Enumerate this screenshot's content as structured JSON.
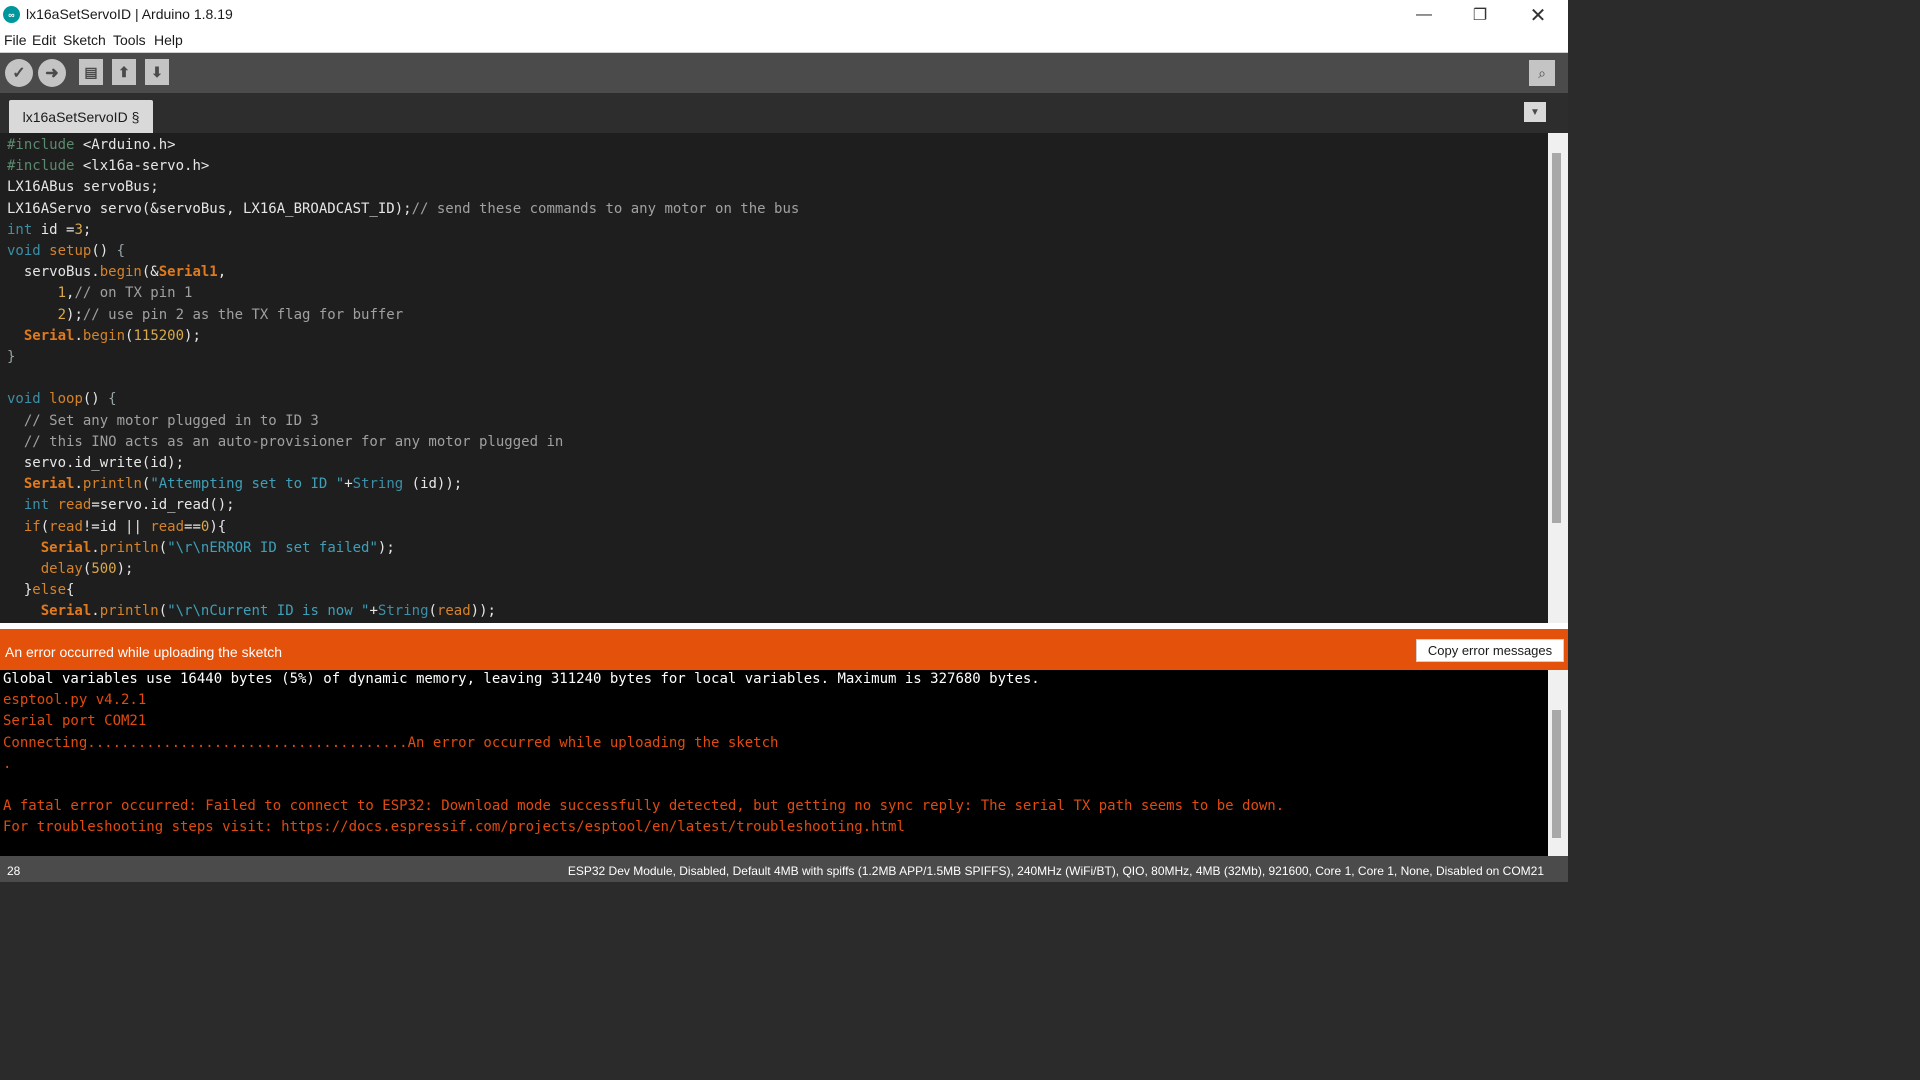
{
  "window": {
    "title": "lx16aSetServoID | Arduino 1.8.19",
    "app_icon_glyph": "∞",
    "minimize_glyph": "—",
    "maximize_glyph": "❐",
    "close_glyph": "✕"
  },
  "menu": [
    "File",
    "Edit",
    "Sketch",
    "Tools",
    "Help"
  ],
  "toolbar": {
    "verify_glyph": "✓",
    "upload_glyph": "➜",
    "new_glyph": "▤",
    "open_glyph": "⬆",
    "save_glyph": "⬇",
    "serial_monitor_glyph": "⌕"
  },
  "tabs": {
    "active": "lx16aSetServoID §",
    "menu_glyph": "▼"
  },
  "editor_lines": [
    [
      [
        "#include",
        "pre"
      ],
      [
        " <Arduino.h>",
        ""
      ]
    ],
    [
      [
        "#include",
        "pre"
      ],
      [
        " <lx16a-servo.h>",
        ""
      ]
    ],
    [
      [
        "LX16ABus servoBus;",
        ""
      ]
    ],
    [
      [
        "LX16AServo servo(&servoBus, LX16A_BROADCAST_ID);",
        ""
      ],
      [
        "// send these commands to any motor on the bus",
        "cm"
      ]
    ],
    [
      [
        "int",
        "kw"
      ],
      [
        " id =",
        ""
      ],
      [
        "3",
        "num"
      ],
      [
        ";",
        ""
      ]
    ],
    [
      [
        "void",
        "kw"
      ],
      [
        " ",
        ""
      ],
      [
        "setup",
        "fn"
      ],
      [
        "() ",
        ""
      ],
      [
        "{",
        "brace"
      ]
    ],
    [
      [
        "  servoBus.",
        ""
      ],
      [
        "begin",
        "fn"
      ],
      [
        "(&",
        ""
      ],
      [
        "Serial1",
        "cls"
      ],
      [
        ",",
        ""
      ]
    ],
    [
      [
        "      ",
        ""
      ],
      [
        "1",
        "num"
      ],
      [
        ",",
        ""
      ],
      [
        "// on TX pin 1",
        "cm"
      ]
    ],
    [
      [
        "      ",
        ""
      ],
      [
        "2",
        "num"
      ],
      [
        ");",
        ""
      ],
      [
        "// use pin 2 as the TX flag for buffer",
        "cm"
      ]
    ],
    [
      [
        "  ",
        ""
      ],
      [
        "Serial",
        "cls"
      ],
      [
        ".",
        ""
      ],
      [
        "begin",
        "fn"
      ],
      [
        "(",
        ""
      ],
      [
        "115200",
        "num"
      ],
      [
        ");",
        ""
      ]
    ],
    [
      [
        "}",
        "brace"
      ]
    ],
    [],
    [
      [
        "void",
        "kw"
      ],
      [
        " ",
        ""
      ],
      [
        "loop",
        "fn"
      ],
      [
        "() ",
        ""
      ],
      [
        "{",
        "brace"
      ]
    ],
    [
      [
        "  // Set any motor plugged in to ID 3",
        "cm"
      ]
    ],
    [
      [
        "  // this INO acts as an auto-provisioner for any motor plugged in",
        "cm"
      ]
    ],
    [
      [
        "  servo.id_write(id);",
        ""
      ]
    ],
    [
      [
        "  ",
        ""
      ],
      [
        "Serial",
        "cls"
      ],
      [
        ".",
        ""
      ],
      [
        "println",
        "fn"
      ],
      [
        "(",
        ""
      ],
      [
        "\"Attempting set to ID \"",
        "str"
      ],
      [
        "+",
        ""
      ],
      [
        "String",
        "kw"
      ],
      [
        " (id));",
        ""
      ]
    ],
    [
      [
        "  ",
        ""
      ],
      [
        "int",
        "kw"
      ],
      [
        " ",
        ""
      ],
      [
        "read",
        "fn"
      ],
      [
        "=servo.id_read();",
        ""
      ]
    ],
    [
      [
        "  ",
        ""
      ],
      [
        "if",
        "fn"
      ],
      [
        "(",
        ""
      ],
      [
        "read",
        "fn"
      ],
      [
        "!=id || ",
        ""
      ],
      [
        "read",
        "fn"
      ],
      [
        "==",
        ""
      ],
      [
        "0",
        "num"
      ],
      [
        "){",
        ""
      ]
    ],
    [
      [
        "    ",
        ""
      ],
      [
        "Serial",
        "cls"
      ],
      [
        ".",
        ""
      ],
      [
        "println",
        "fn"
      ],
      [
        "(",
        ""
      ],
      [
        "\"\\r\\nERROR ID set failed\"",
        "str"
      ],
      [
        ");",
        ""
      ]
    ],
    [
      [
        "    ",
        ""
      ],
      [
        "delay",
        "fn"
      ],
      [
        "(",
        ""
      ],
      [
        "500",
        "num"
      ],
      [
        ");",
        ""
      ]
    ],
    [
      [
        "  }",
        ""
      ],
      [
        "else",
        "fn"
      ],
      [
        "{",
        ""
      ]
    ],
    [
      [
        "    ",
        ""
      ],
      [
        "Serial",
        "cls"
      ],
      [
        ".",
        ""
      ],
      [
        "println",
        "fn"
      ],
      [
        "(",
        ""
      ],
      [
        "\"\\r\\nCurrent ID is now \"",
        "str"
      ],
      [
        "+",
        ""
      ],
      [
        "String",
        "kw"
      ],
      [
        "(",
        ""
      ],
      [
        "read",
        "fn"
      ],
      [
        "));",
        ""
      ]
    ]
  ],
  "error_bar": {
    "message": "An error occurred while uploading the sketch",
    "copy_button": "Copy error messages"
  },
  "console_lines": [
    [
      "Global variables use 16440 bytes (5%) of dynamic memory, leaving 311240 bytes for local variables. Maximum is 327680 bytes.",
      "white"
    ],
    [
      "esptool.py v4.2.1",
      "err"
    ],
    [
      "Serial port COM21",
      "err"
    ],
    [
      "Connecting......................................An error occurred while uploading the sketch",
      "err"
    ],
    [
      ".",
      "err"
    ],
    [
      "",
      "err"
    ],
    [
      "A fatal error occurred: Failed to connect to ESP32: Download mode successfully detected, but getting no sync reply: The serial TX path seems to be down.",
      "err"
    ],
    [
      "For troubleshooting steps visit: https://docs.espressif.com/projects/esptool/en/latest/troubleshooting.html",
      "err"
    ]
  ],
  "status": {
    "line_number": "28",
    "board": "ESP32 Dev Module, Disabled, Default 4MB with spiffs (1.2MB APP/1.5MB SPIFFS), 240MHz (WiFi/BT), QIO, 80MHz, 4MB (32Mb), 921600, Core 1, Core 1, None, Disabled on COM21"
  }
}
